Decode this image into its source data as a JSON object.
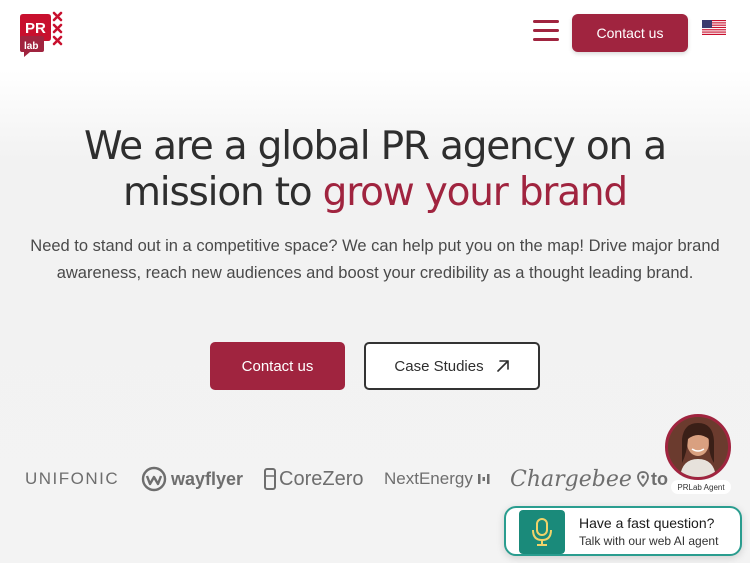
{
  "header": {
    "logo_text_top": "PR",
    "logo_text_bottom": "lab",
    "contact_label": "Contact us",
    "flag": "us-flag-icon"
  },
  "hero": {
    "title_line1": "We are a global PR agency on a",
    "title_line2_plain": "mission to ",
    "title_line2_accent": "grow your brand",
    "subtitle": "Need to stand out in a competitive space? We can help put you on the map! Drive major brand awareness, reach new audiences and boost your credibility as a thought leading brand.",
    "contact_label": "Contact us",
    "case_label": "Case Studies"
  },
  "logos": {
    "unifonic": "UNIFONIC",
    "wayflyer": "wayflyer",
    "corezero": "CoreZero",
    "nextenergy": "NextEnergy",
    "chargebee": "Chargebee",
    "to": "to"
  },
  "agent": {
    "name": "PRLab Agent",
    "chat_title": "Have a fast question?",
    "chat_sub": "Talk with our web AI agent"
  },
  "colors": {
    "brand": "#a0243f",
    "agent_teal": "#1a8a7a"
  }
}
